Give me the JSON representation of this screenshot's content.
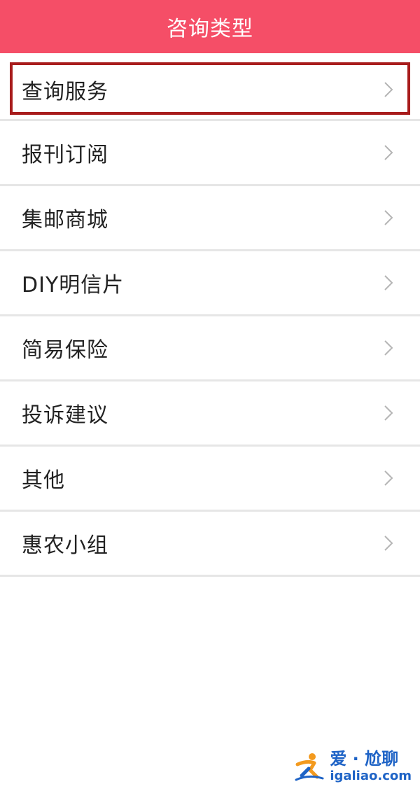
{
  "header": {
    "title": "咨询类型"
  },
  "list": {
    "items": [
      {
        "label": "查询服务"
      },
      {
        "label": "报刊订阅"
      },
      {
        "label": "集邮商城"
      },
      {
        "label": "DIY明信片"
      },
      {
        "label": "简易保险"
      },
      {
        "label": "投诉建议"
      },
      {
        "label": "其他"
      },
      {
        "label": "惠农小组"
      }
    ],
    "highlighted_index": 0,
    "chevron_icon": "chevron-right-icon"
  },
  "watermark": {
    "line1": "爱 · 尬聊",
    "line2": "igaliao.com",
    "logo_icon": "runner-logo-icon"
  },
  "colors": {
    "header_bg": "#f54e67",
    "highlight_border": "#a81c1c",
    "divider": "#e6e6e6",
    "watermark_blue": "#1e63c6",
    "watermark_orange": "#f39a1e"
  }
}
